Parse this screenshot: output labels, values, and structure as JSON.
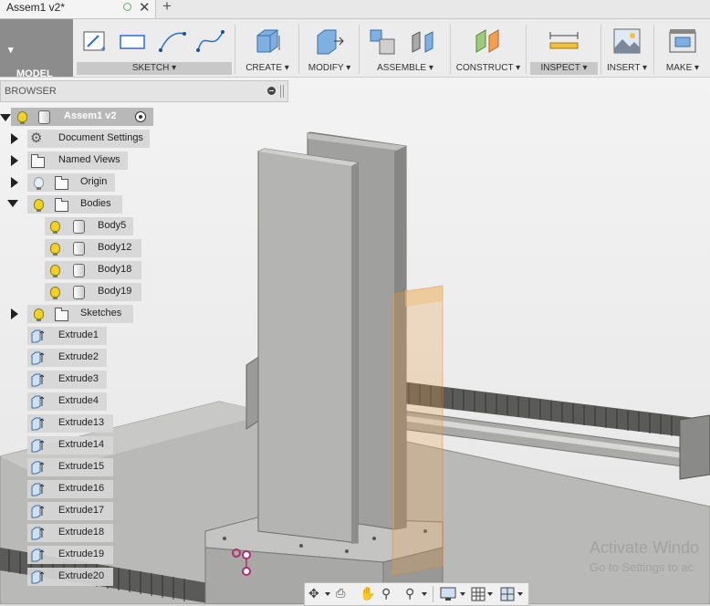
{
  "tab": {
    "title": "Assem1 v2*",
    "close": "✕",
    "new": "+"
  },
  "toolbar": {
    "workspace": "MODEL",
    "groups": [
      {
        "label": "SKETCH ▾"
      },
      {
        "label": "CREATE ▾"
      },
      {
        "label": "MODIFY ▾"
      },
      {
        "label": "ASSEMBLE ▾"
      },
      {
        "label": "CONSTRUCT ▾"
      },
      {
        "label": "INSPECT ▾"
      },
      {
        "label": "INSERT ▾"
      },
      {
        "label": "MAKE ▾"
      }
    ]
  },
  "browser": {
    "header": "BROWSER",
    "root": "Assem1 v2",
    "items": {
      "document_settings": "Document Settings",
      "named_views": "Named Views",
      "origin": "Origin",
      "bodies": "Bodies",
      "sketches": "Sketches"
    },
    "bodies": [
      "Body5",
      "Body12",
      "Body18",
      "Body19"
    ],
    "features": [
      "Extrude1",
      "Extrude2",
      "Extrude3",
      "Extrude4",
      "Extrude13",
      "Extrude14",
      "Extrude15",
      "Extrude16",
      "Extrude17",
      "Extrude18",
      "Extrude19",
      "Extrude20"
    ]
  },
  "watermark": {
    "line1": "Activate Windo",
    "line2": "Go to Settings to ac"
  },
  "colors": {
    "accent_bulb": "#f2d226",
    "toolbar_active": "#8c8c8c",
    "highlight": "#e8a04c"
  }
}
